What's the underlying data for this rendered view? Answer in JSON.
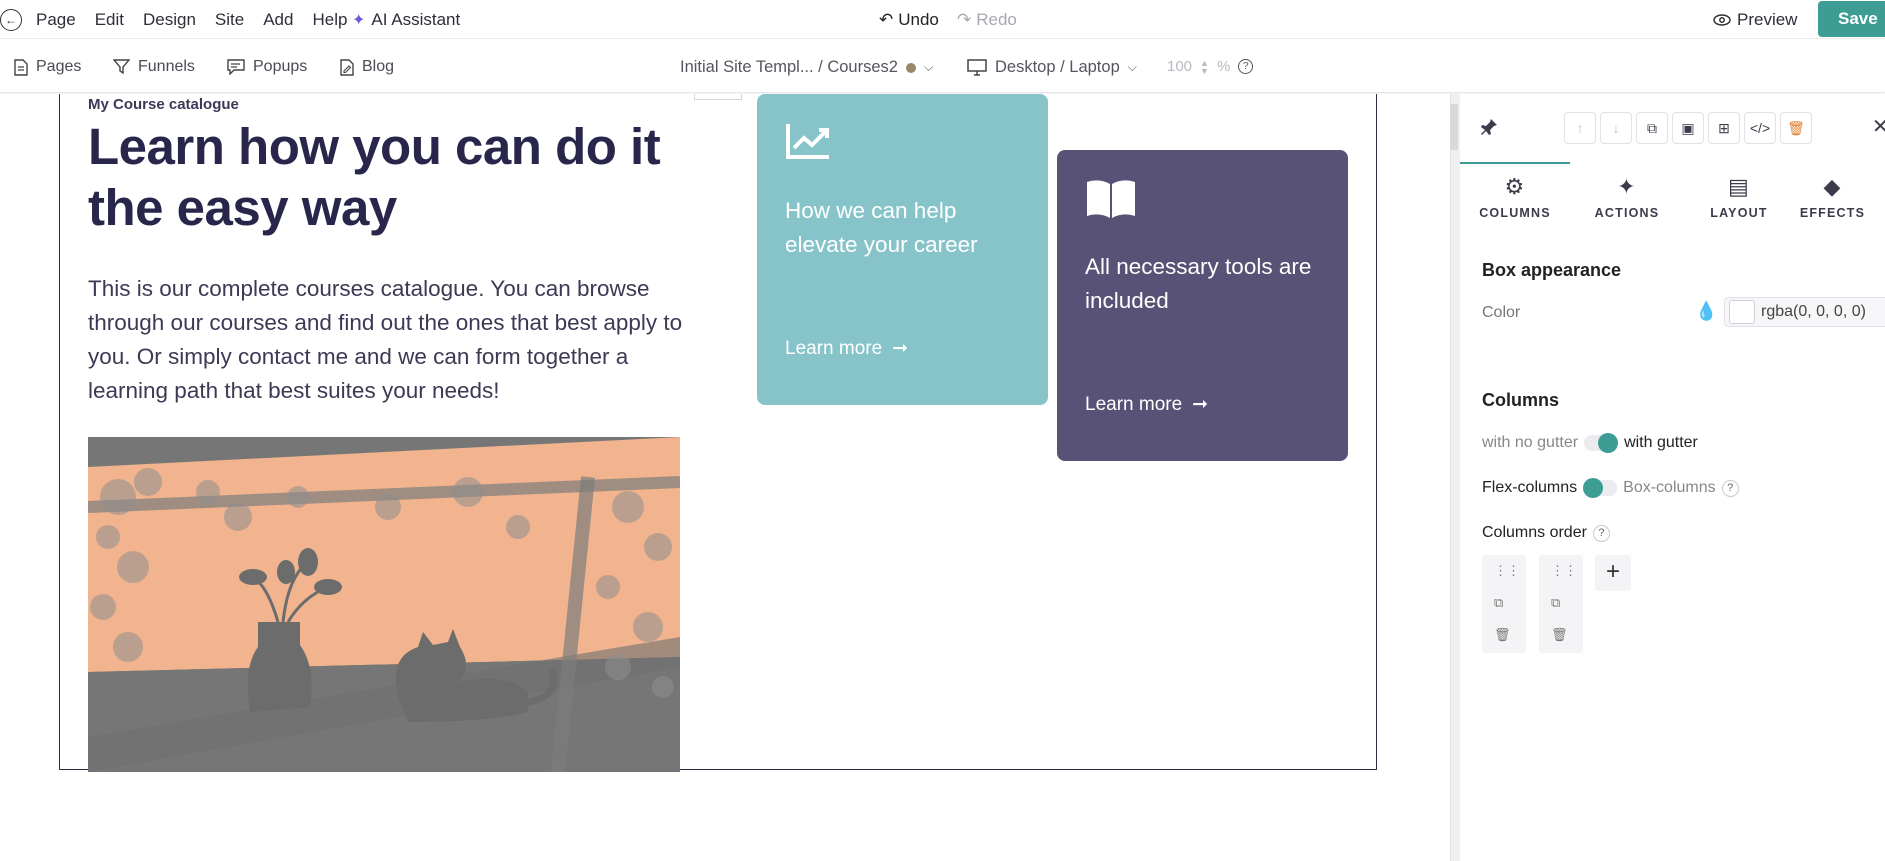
{
  "menu": {
    "items": [
      "Page",
      "Edit",
      "Design",
      "Site",
      "Add",
      "Help"
    ],
    "ai_assistant": "AI Assistant",
    "undo": "Undo",
    "redo": "Redo",
    "preview": "Preview",
    "save": "Save"
  },
  "toolbar": {
    "pages": "Pages",
    "funnels": "Funnels",
    "popups": "Popups",
    "blog": "Blog",
    "site_path": "Initial Site Templ... / Courses2",
    "device": "Desktop / Laptop",
    "zoom_value": "100",
    "zoom_unit": "%",
    "help": "?"
  },
  "canvas": {
    "eyebrow": "My Course catalogue",
    "title": "Learn how you can do it the easy way",
    "body": "This is our complete courses catalogue. You can browse through our courses and find out the ones that best apply to you. Or simply contact me and we can form together a learning path that best suites your needs!",
    "cards": [
      {
        "text": "How we can help elevate your career",
        "link": "Learn more",
        "icon": "chart-icon",
        "color": "#86c4ca"
      },
      {
        "text": "All necessary tools are included",
        "link": "Learn more",
        "icon": "book-icon",
        "color": "#575276"
      }
    ]
  },
  "panel": {
    "tabs": [
      "COLUMNS",
      "ACTIONS",
      "LAYOUT",
      "EFFECTS"
    ],
    "box_appearance": "Box appearance",
    "color_label": "Color",
    "color_value": "rgba(0, 0, 0, 0)",
    "columns_title": "Columns",
    "no_gutter": "with no gutter",
    "with_gutter": "with gutter",
    "flex_columns": "Flex-columns",
    "box_columns": "Box-columns",
    "columns_order": "Columns order",
    "help": "?"
  },
  "colors": {
    "accent": "#3d9d94",
    "heading": "#28264a"
  }
}
